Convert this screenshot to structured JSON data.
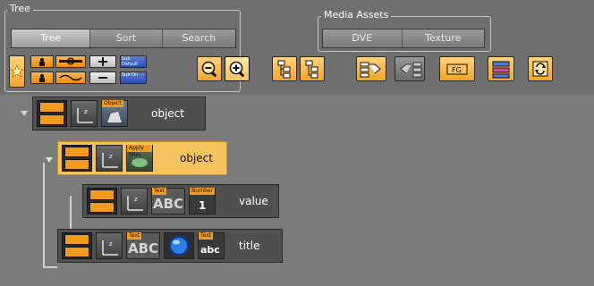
{
  "groups": {
    "tree": {
      "title": "Tree",
      "tabs": [
        "Tree",
        "Sort",
        "Search"
      ],
      "active_tab": 0
    },
    "media": {
      "title": "Media Assets",
      "tabs": [
        "DVE",
        "Texture"
      ]
    }
  },
  "toolbar": {
    "icons": [
      "star-icon",
      "person-icon",
      "container-icon",
      "plus-icon",
      "subdir-icon",
      "person-small-icon",
      "wave-icon",
      "minus-icon",
      "subdir-off-icon",
      "zoom-out-icon",
      "zoom-in-icon",
      "tree-expand-icon",
      "tree-collapse-icon",
      "branch-right-icon",
      "branch-left-icon",
      "fg-icon",
      "layers-icon",
      "refresh-icon"
    ],
    "small_tags": {
      "sub_default": "Sub Default",
      "sub_on": "Sub On"
    }
  },
  "tree": {
    "nodes": [
      {
        "label": "object",
        "plugin": "Object",
        "selected": false
      },
      {
        "label": "object",
        "plugin": "Apply Shm",
        "selected": true
      },
      {
        "label": "value",
        "plugins": [
          "Text",
          "Number"
        ],
        "selected": false
      },
      {
        "label": "title",
        "plugins": [
          "Text",
          "Text"
        ],
        "selected": false
      }
    ],
    "tile_glyphs": {
      "abc": "ABC",
      "abc_small": "abc",
      "number": "1"
    }
  },
  "colors": {
    "accent": "#f29b1e",
    "selected": "#f6c25c",
    "panel": "#6f6f6f"
  }
}
